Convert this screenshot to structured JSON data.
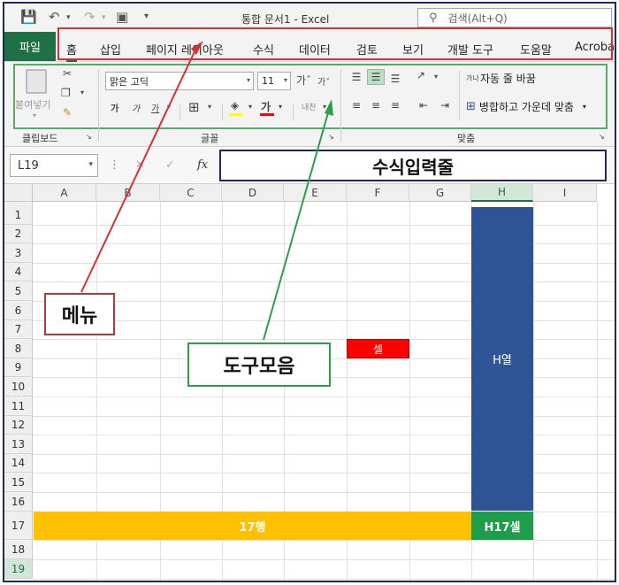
{
  "titlebar": {
    "title": "통합 문서1  -  Excel",
    "search_placeholder": "검색(Alt+Q)",
    "icons": [
      "save-icon",
      "undo-icon",
      "redo-icon",
      "camera-icon",
      "customize-icon"
    ]
  },
  "menu": {
    "file": "파일",
    "items": [
      "홈",
      "삽입",
      "페이지 레이아웃",
      "수식",
      "데이터",
      "검토",
      "보기",
      "개발 도구",
      "도움말",
      "Acroba"
    ],
    "active": "홈"
  },
  "ribbon": {
    "clipboard": {
      "paste": "붙여넣기",
      "label": "클립보드"
    },
    "font": {
      "name": "맑은 고딕",
      "size": "11",
      "label": "글꼴",
      "grow": "가",
      "shrink": "가",
      "bold": "가",
      "italic": "가",
      "underline": "가",
      "phonetic": "내천"
    },
    "alignment": {
      "wrap": "자동 줄 바꿈",
      "merge": "병합하고 가운데 맞춤",
      "label": "맞춤",
      "wrap_icon_text": "가나"
    }
  },
  "formula_bar": {
    "name_box": "L19",
    "fx": "fx",
    "input_text": "수식입력줄"
  },
  "sheet": {
    "columns": [
      "A",
      "B",
      "C",
      "D",
      "E",
      "F",
      "G",
      "H",
      "I"
    ],
    "selected_column": "H",
    "rows": [
      "1",
      "2",
      "3",
      "4",
      "5",
      "6",
      "7",
      "8",
      "9",
      "10",
      "11",
      "12",
      "13",
      "14",
      "15",
      "16",
      "17",
      "18",
      "19"
    ],
    "selected_row": "19",
    "cells": {
      "h_column": "H열",
      "row17": "17행",
      "h17": "H17셀",
      "f8": "셀"
    }
  },
  "annotations": {
    "menu": "메뉴",
    "toolbar": "도구모음"
  },
  "colors": {
    "excel_green": "#1e7145",
    "h_column": "#2f5496",
    "row17": "#ffc000",
    "h17": "#1e9e4a",
    "f8": "#ff0000",
    "menu_callout": "#d23232",
    "toolbar_callout": "#2e9e48",
    "formula_callout": "#1e2a5a"
  }
}
